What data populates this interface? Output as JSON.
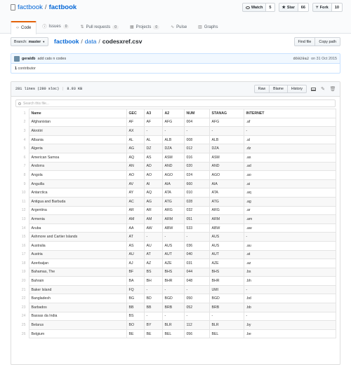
{
  "repo": {
    "owner": "factbook",
    "separator": "/",
    "name": "factbook"
  },
  "actions": [
    {
      "label": "Watch",
      "count": "5"
    },
    {
      "label": "Star",
      "count": "66"
    },
    {
      "label": "Fork",
      "count": "10"
    }
  ],
  "nav": {
    "code": "Code",
    "issues": "Issues",
    "issues_count": "0",
    "pulls": "Pull requests",
    "pulls_count": "0",
    "projects": "Projects",
    "projects_count": "0",
    "pulse": "Pulse",
    "graphs": "Graphs"
  },
  "file_nav": {
    "branch_label": "Branch:",
    "branch": "master",
    "path": [
      "factbook",
      "data",
      "codesxref.csv"
    ],
    "find_file": "Find file",
    "copy_path": "Copy path"
  },
  "commit": {
    "author": "geraldb",
    "message": "add cats n codes",
    "sha": "d6929a2",
    "date": "on 31 Oct 2015"
  },
  "contributors": {
    "count": "1",
    "label": "contributor"
  },
  "file": {
    "lines": "281 lines (280 sloc)",
    "size": "8.93 KB",
    "raw": "Raw",
    "blame": "Blame",
    "history": "History",
    "search_placeholder": "Search this file..."
  },
  "table": {
    "headers": [
      "Name",
      "GEC",
      "A3",
      "A2",
      "NUM",
      "STANAG",
      "INTERNET"
    ],
    "rows": [
      [
        "2",
        "Afghanistan",
        "AF",
        "AF",
        "AFG",
        "004",
        "AFG",
        ".af"
      ],
      [
        "3",
        "Akrotiri",
        "AX",
        "-",
        "-",
        "-",
        "-",
        "-"
      ],
      [
        "4",
        "Albania",
        "AL",
        "AL",
        "ALB",
        "008",
        "ALB",
        ".al"
      ],
      [
        "5",
        "Algeria",
        "AG",
        "DZ",
        "DZA",
        "012",
        "DZA",
        ".dz"
      ],
      [
        "6",
        "American Samoa",
        "AQ",
        "AS",
        "ASM",
        "016",
        "ASM",
        ".as"
      ],
      [
        "7",
        "Andorra",
        "AN",
        "AD",
        "AND",
        "020",
        "AND",
        ".ad"
      ],
      [
        "8",
        "Angola",
        "AO",
        "AO",
        "AGO",
        "024",
        "AGO",
        ".ao"
      ],
      [
        "9",
        "Anguilla",
        "AV",
        "AI",
        "AIA",
        "660",
        "AIA",
        ".ai"
      ],
      [
        "10",
        "Antarctica",
        "AY",
        "AQ",
        "ATA",
        "010",
        "ATA",
        ".aq"
      ],
      [
        "11",
        "Antigua and Barbuda",
        "AC",
        "AG",
        "ATG",
        "028",
        "ATG",
        ".ag"
      ],
      [
        "12",
        "Argentina",
        "AR",
        "AR",
        "ARG",
        "032",
        "ARG",
        ".ar"
      ],
      [
        "13",
        "Armenia",
        "AM",
        "AM",
        "ARM",
        "051",
        "ARM",
        ".am"
      ],
      [
        "14",
        "Aruba",
        "AA",
        "AW",
        "ABW",
        "533",
        "ABW",
        ".aw"
      ],
      [
        "15",
        "Ashmore and Cartier Islands",
        "AT",
        "-",
        "-",
        "-",
        "AUS",
        "-"
      ],
      [
        "16",
        "Australia",
        "AS",
        "AU",
        "AUS",
        "036",
        "AUS",
        ".au"
      ],
      [
        "17",
        "Austria",
        "AU",
        "AT",
        "AUT",
        "040",
        "AUT",
        ".at"
      ],
      [
        "18",
        "Azerbaijan",
        "AJ",
        "AZ",
        "AZE",
        "031",
        "AZE",
        ".az"
      ],
      [
        "19",
        "Bahamas, The",
        "BF",
        "BS",
        "BHS",
        "044",
        "BHS",
        ".bs"
      ],
      [
        "20",
        "Bahrain",
        "BA",
        "BH",
        "BHR",
        "048",
        "BHR",
        ".bh"
      ],
      [
        "21",
        "Baker Island",
        "FQ",
        "-",
        "-",
        "-",
        "UMI",
        "-"
      ],
      [
        "22",
        "Bangladesh",
        "BG",
        "BD",
        "BGD",
        "050",
        "BGD",
        ".bd"
      ],
      [
        "23",
        "Barbados",
        "BB",
        "BB",
        "BRB",
        "052",
        "BRB",
        ".bb"
      ],
      [
        "24",
        "Bassas da India",
        "BS",
        "-",
        "-",
        "-",
        "-",
        "-"
      ],
      [
        "25",
        "Belarus",
        "BO",
        "BY",
        "BLR",
        "112",
        "BLR",
        ".by"
      ],
      [
        "26",
        "Belgium",
        "BE",
        "BE",
        "BEL",
        "056",
        "BEL",
        ".be"
      ]
    ]
  }
}
